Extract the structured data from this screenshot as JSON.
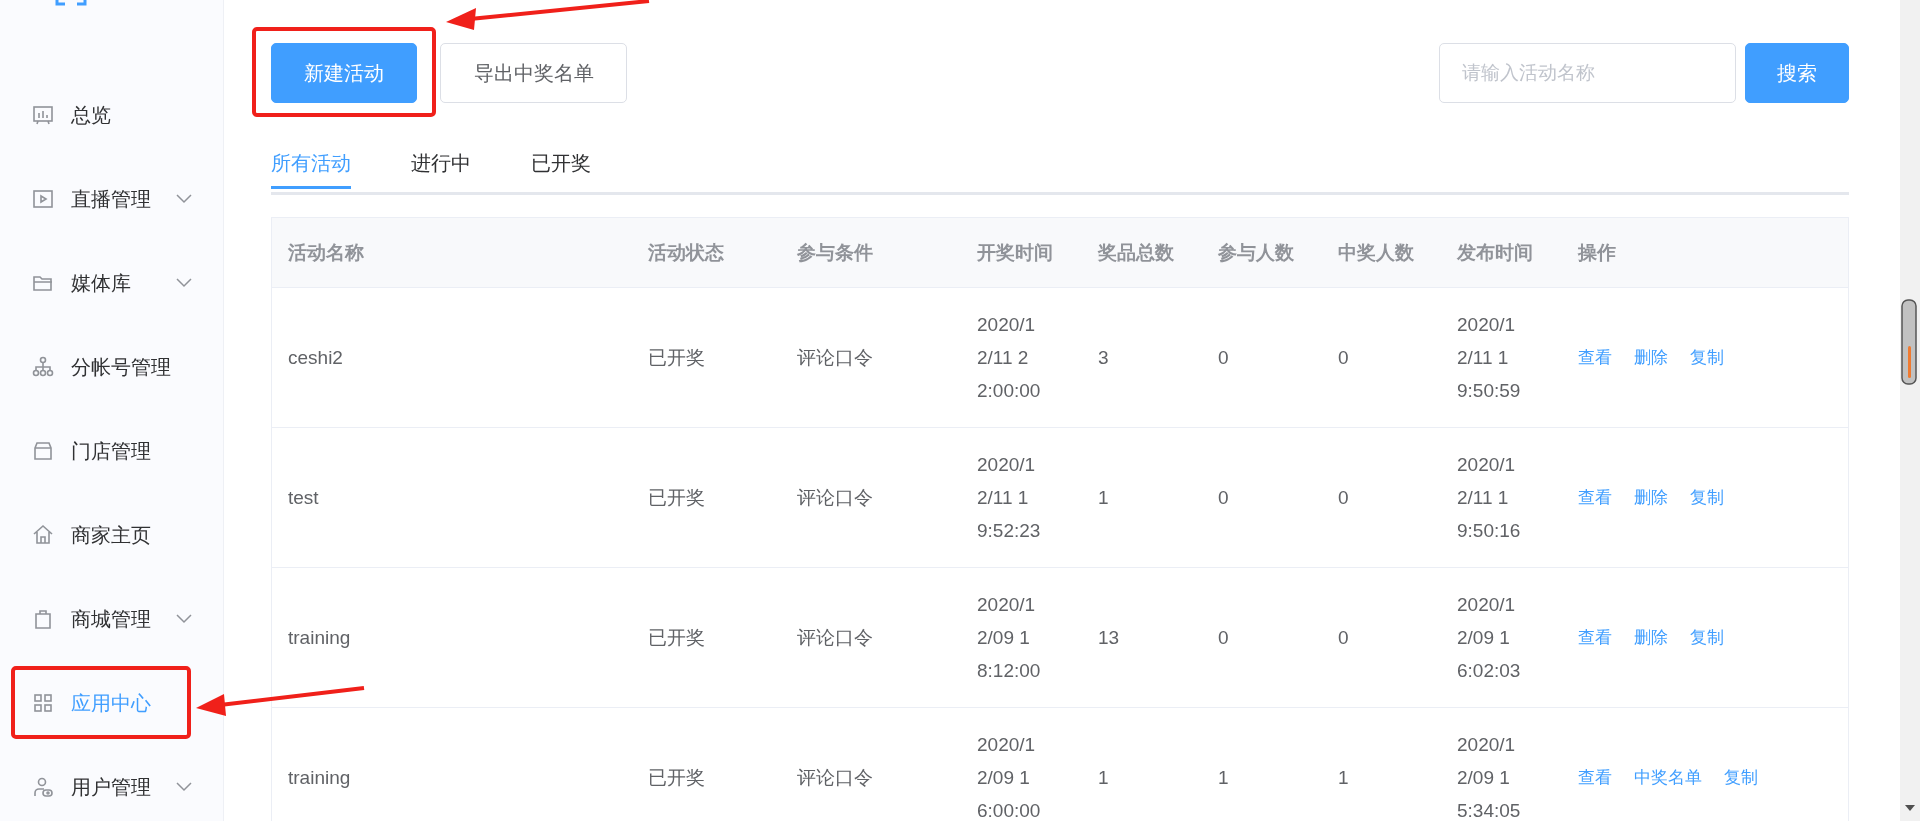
{
  "sidebar": {
    "items": [
      {
        "label": "总览",
        "expandable": false,
        "selected": false
      },
      {
        "label": "直播管理",
        "expandable": true,
        "selected": false
      },
      {
        "label": "媒体库",
        "expandable": true,
        "selected": false
      },
      {
        "label": "分帐号管理",
        "expandable": false,
        "selected": false
      },
      {
        "label": "门店管理",
        "expandable": false,
        "selected": false
      },
      {
        "label": "商家主页",
        "expandable": false,
        "selected": false
      },
      {
        "label": "商城管理",
        "expandable": true,
        "selected": false
      },
      {
        "label": "应用中心",
        "expandable": false,
        "selected": true
      },
      {
        "label": "用户管理",
        "expandable": true,
        "selected": false
      }
    ]
  },
  "toolbar": {
    "buttons": [
      {
        "label": "新建活动",
        "kind": "primary"
      },
      {
        "label": "导出中奖名单",
        "kind": "plain"
      }
    ],
    "search": {
      "placeholder": "请输入活动名称",
      "button": "搜索"
    }
  },
  "tabs": [
    {
      "label": "所有活动",
      "selected": true
    },
    {
      "label": "进行中",
      "selected": false
    },
    {
      "label": "已开奖",
      "selected": false
    }
  ],
  "table": {
    "columns": [
      "活动名称",
      "活动状态",
      "参与条件",
      "开奖时间",
      "奖品总数",
      "参与人数",
      "中奖人数",
      "发布时间",
      "操作"
    ],
    "rows": [
      {
        "cells": [
          "ceshi2",
          "已开奖",
          "评论口令",
          "2020/12/11 22:00:00",
          "3",
          "0",
          "0",
          "2020/12/11 19:50:59"
        ],
        "actions": [
          "查看",
          "删除",
          "复制"
        ]
      },
      {
        "cells": [
          "test",
          "已开奖",
          "评论口令",
          "2020/12/11 19:52:23",
          "1",
          "0",
          "0",
          "2020/12/11 19:50:16"
        ],
        "actions": [
          "查看",
          "删除",
          "复制"
        ]
      },
      {
        "cells": [
          "training",
          "已开奖",
          "评论口令",
          "2020/12/09 18:12:00",
          "13",
          "0",
          "0",
          "2020/12/09 16:02:03"
        ],
        "actions": [
          "查看",
          "删除",
          "复制"
        ]
      },
      {
        "cells": [
          "training",
          "已开奖",
          "评论口令",
          "2020/12/09 16:00:00",
          "1",
          "1",
          "1",
          "2020/12/09 15:34:05"
        ],
        "actions": [
          "查看",
          "中奖名单",
          "复制"
        ]
      }
    ]
  }
}
